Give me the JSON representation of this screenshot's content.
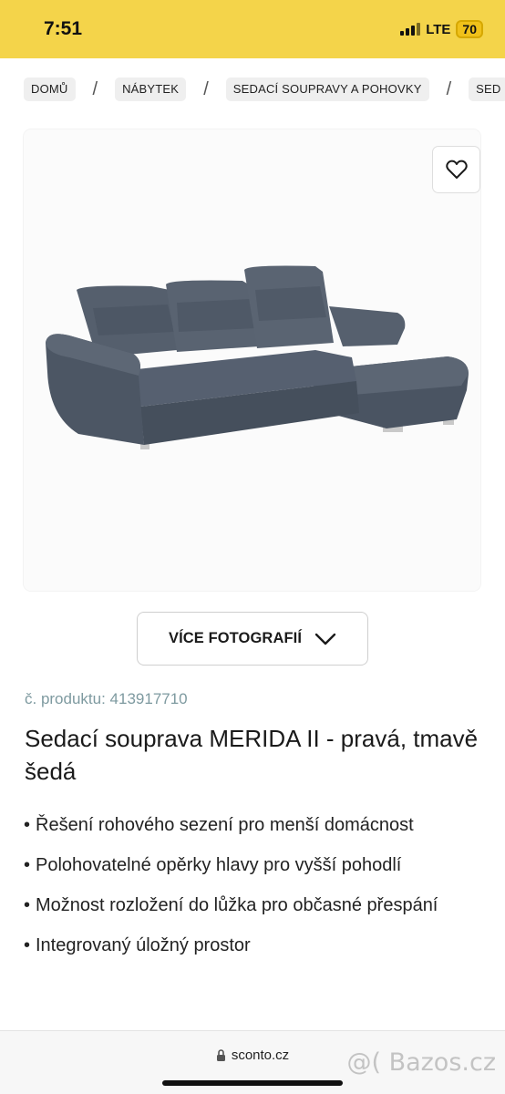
{
  "status_bar": {
    "time": "7:51",
    "network": "LTE",
    "battery": "70"
  },
  "breadcrumb": [
    {
      "label": "DOMŮ"
    },
    {
      "label": "NÁBYTEK"
    },
    {
      "label": "SEDACÍ SOUPRAVY A POHOVKY"
    },
    {
      "label": "SED"
    }
  ],
  "product": {
    "more_photos_label": "VÍCE FOTOGRAFIÍ",
    "product_number": "č. produktu: 413917710",
    "title": "Sedací souprava MERIDA II - pravá, tmavě šedá",
    "features": [
      "Řešení rohového sezení pro menší domácnost",
      "Polohovatelné opěrky hlavy pro vyšší pohodlí",
      "Možnost rozložení do lůžka pro občasné přespání",
      "Integrovaný úložný prostor"
    ]
  },
  "browser": {
    "url": "sconto.cz"
  },
  "watermark": "@( Bazos.cz",
  "colors": {
    "status_bar": "#f4d44a",
    "accent_text": "#7e9aa0",
    "sofa": "#4e5866"
  }
}
